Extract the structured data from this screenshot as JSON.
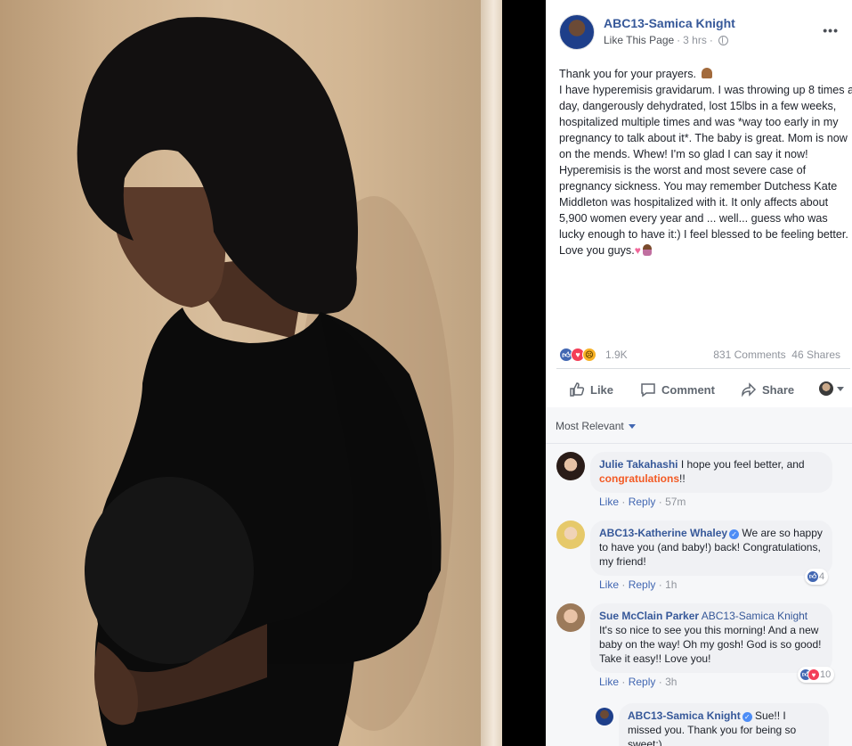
{
  "colors": {
    "link": "#365899",
    "accent": "#4267b2",
    "highlight": "#f35a24",
    "muted": "#90949c"
  },
  "post": {
    "page_name": "ABC13-Samica Knight",
    "like_page": "Like This Page",
    "sep": "·",
    "time": "3 hrs",
    "more": "•••",
    "text_lines": [
      "Thank you for your prayers.",
      "I have hyperemisis gravidarum. I was throwing up 8 times a day, dangerously dehydrated, lost 15lbs in a few weeks, hospitalized multiple times and was *way too early in my pregnancy to talk about it*. The baby is great. Mom is now on the mends. Whew! I'm so glad I can say it now!",
      "Hyperemisis is the worst and most severe case of pregnancy sickness. You may remember Dutchess Kate Middleton was hospitalized with it. It only affects about 5,900 women every year and ... well... guess who was lucky enough to have it:) I feel blessed to be feeling better. Love you guys."
    ],
    "icons": [
      "folded-hands-emoji",
      "pink-heart-emoji",
      "pregnant-woman-emoji",
      "globe-icon"
    ]
  },
  "stats": {
    "reactions": "1.9K",
    "comments": "831 Comments",
    "shares": "46 Shares"
  },
  "actions": {
    "like": "Like",
    "comment": "Comment",
    "share": "Share"
  },
  "sort_label": "Most Relevant",
  "comments": [
    {
      "author": "Julie Takahashi",
      "text_before": " I hope you feel better, and ",
      "highlight": "congratulations",
      "text_after": "!!",
      "like": "Like",
      "reply": "Reply",
      "time": "57m"
    },
    {
      "author": "ABC13-Katherine Whaley",
      "text": " We are so happy to have you (and baby!) back! Congratulations, my friend!",
      "like": "Like",
      "reply": "Reply",
      "time": "1h",
      "reaction_count": "4"
    },
    {
      "author": "Sue McClain Parker",
      "tag": " ABC13-Samica Knight",
      "text": " It's so nice to see you this morning! And a new baby on the way! Oh my gosh! God is so good! Take it easy!! Love you!",
      "like": "Like",
      "reply": "Reply",
      "time": "3h",
      "reaction_count": "10"
    },
    {
      "author": "ABC13-Samica Knight",
      "text": " Sue!! I missed you. Thank you for being so sweet:)"
    }
  ],
  "dot": "·"
}
